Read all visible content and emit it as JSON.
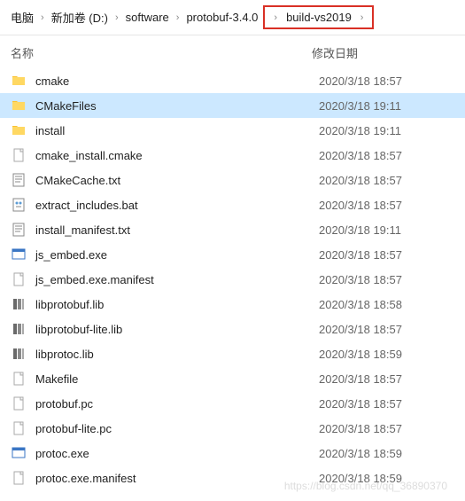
{
  "breadcrumb": {
    "items": [
      {
        "label": "电脑"
      },
      {
        "label": "新加卷 (D:)"
      },
      {
        "label": "software"
      },
      {
        "label": "protobuf-3.4.0"
      },
      {
        "label": "build-vs2019",
        "highlight": true
      }
    ]
  },
  "columns": {
    "name": "名称",
    "date": "修改日期"
  },
  "files": [
    {
      "icon": "folder",
      "name": "cmake",
      "date": "2020/3/18 18:57",
      "selected": false
    },
    {
      "icon": "folder",
      "name": "CMakeFiles",
      "date": "2020/3/18 19:11",
      "selected": true
    },
    {
      "icon": "folder",
      "name": "install",
      "date": "2020/3/18 19:11",
      "selected": false
    },
    {
      "icon": "file",
      "name": "cmake_install.cmake",
      "date": "2020/3/18 18:57",
      "selected": false
    },
    {
      "icon": "txt",
      "name": "CMakeCache.txt",
      "date": "2020/3/18 18:57",
      "selected": false
    },
    {
      "icon": "bat",
      "name": "extract_includes.bat",
      "date": "2020/3/18 18:57",
      "selected": false
    },
    {
      "icon": "txt",
      "name": "install_manifest.txt",
      "date": "2020/3/18 19:11",
      "selected": false
    },
    {
      "icon": "exe",
      "name": "js_embed.exe",
      "date": "2020/3/18 18:57",
      "selected": false
    },
    {
      "icon": "file",
      "name": "js_embed.exe.manifest",
      "date": "2020/3/18 18:57",
      "selected": false
    },
    {
      "icon": "lib",
      "name": "libprotobuf.lib",
      "date": "2020/3/18 18:58",
      "selected": false
    },
    {
      "icon": "lib",
      "name": "libprotobuf-lite.lib",
      "date": "2020/3/18 18:57",
      "selected": false
    },
    {
      "icon": "lib",
      "name": "libprotoc.lib",
      "date": "2020/3/18 18:59",
      "selected": false
    },
    {
      "icon": "file",
      "name": "Makefile",
      "date": "2020/3/18 18:57",
      "selected": false
    },
    {
      "icon": "file",
      "name": "protobuf.pc",
      "date": "2020/3/18 18:57",
      "selected": false
    },
    {
      "icon": "file",
      "name": "protobuf-lite.pc",
      "date": "2020/3/18 18:57",
      "selected": false
    },
    {
      "icon": "exe",
      "name": "protoc.exe",
      "date": "2020/3/18 18:59",
      "selected": false
    },
    {
      "icon": "file",
      "name": "protoc.exe.manifest",
      "date": "2020/3/18 18:59",
      "selected": false
    }
  ],
  "watermark": "https://blog.csdn.net/qq_36890370"
}
